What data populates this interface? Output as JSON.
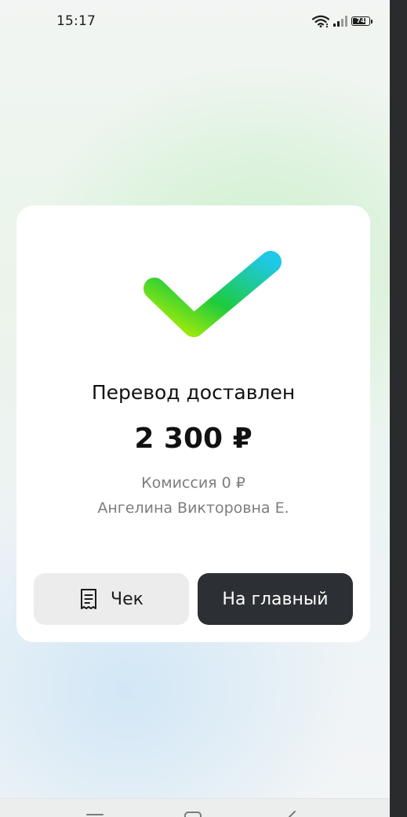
{
  "status_bar": {
    "time": "15:17",
    "battery": "74"
  },
  "card": {
    "title": "Перевод доставлен",
    "amount": "2 300 ₽",
    "commission": "Комиссия 0 ₽",
    "recipient": "Ангелина Викторовна Е."
  },
  "buttons": {
    "receipt_label": "Чек",
    "home_label": "На главный"
  },
  "colors": {
    "check_gradient_start": "#b6f000",
    "check_gradient_mid": "#1ecb3e",
    "check_gradient_end": "#1ec8e6",
    "primary_button": "#2c2f33",
    "secondary_button": "#ececec"
  },
  "icons": {
    "success": "check-icon",
    "receipt": "receipt-icon",
    "wifi": "wifi-icon",
    "signal": "signal-icon",
    "battery": "battery-icon"
  }
}
